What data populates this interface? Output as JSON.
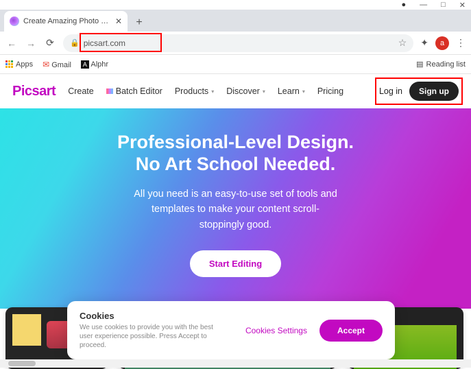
{
  "browser": {
    "window_controls": {
      "record": "●",
      "minimize": "—",
      "maximize": "□",
      "close": "✕"
    },
    "tab": {
      "title": "Create Amazing Photo & Video |"
    },
    "url": "picsart.com",
    "avatar_letter": "a",
    "bookmarks": {
      "apps": "Apps",
      "gmail": "Gmail",
      "alphr": "Alphr",
      "reading_list": "Reading list"
    }
  },
  "header": {
    "logo": "Picsart",
    "nav": {
      "create": "Create",
      "batch": "Batch Editor",
      "products": "Products",
      "discover": "Discover",
      "learn": "Learn",
      "pricing": "Pricing"
    },
    "auth": {
      "login": "Log in",
      "signup": "Sign up"
    }
  },
  "hero": {
    "title_line1": "Professional-Level Design.",
    "title_line2": "No Art School Needed.",
    "sub_line1": "All you need is an easy-to-use set of tools and",
    "sub_line2": "templates to make your content scroll-",
    "sub_line3": "stoppingly good.",
    "cta": "Start Editing"
  },
  "cookies": {
    "title": "Cookies",
    "body": "We use cookies to provide you with the best user experience possible. Press Accept to proceed.",
    "settings": "Cookies Settings",
    "accept": "Accept"
  }
}
